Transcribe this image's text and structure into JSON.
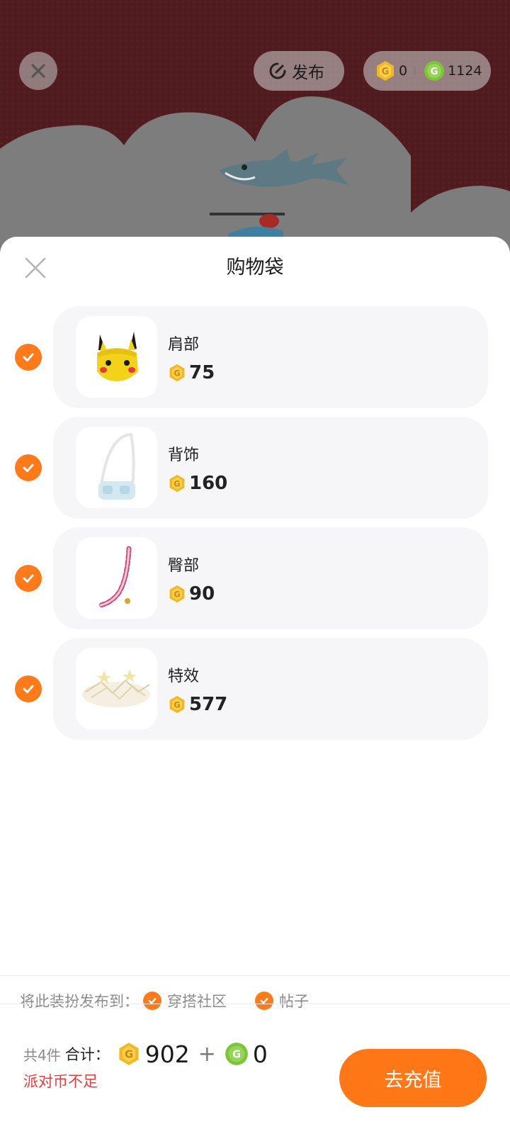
{
  "header": {
    "publish_label": "发布",
    "gold_coins": "0",
    "green_coins": "1124"
  },
  "sheet": {
    "title": "购物袋",
    "items": [
      {
        "name": "肩部",
        "price": "75",
        "checked": true
      },
      {
        "name": "背饰",
        "price": "160",
        "checked": true
      },
      {
        "name": "臀部",
        "price": "90",
        "checked": true
      },
      {
        "name": "特效",
        "price": "577",
        "checked": true
      }
    ]
  },
  "publish_to": {
    "label": "将此装扮发布到：",
    "options": [
      {
        "label": "穿搭社区",
        "checked": true
      },
      {
        "label": "帖子",
        "checked": true
      }
    ]
  },
  "footer": {
    "count_text": "共4件",
    "total_label": "合计：",
    "gold_total": "902",
    "plus": "+",
    "green_total": "0",
    "warning": "派对币不足",
    "recharge_label": "去充值"
  },
  "colors": {
    "accent": "#ff7716",
    "gold_coin": "#f2b824",
    "green_coin": "#7cc43a",
    "warning": "#e83a3a",
    "scene_bg": "#4f1b20"
  }
}
